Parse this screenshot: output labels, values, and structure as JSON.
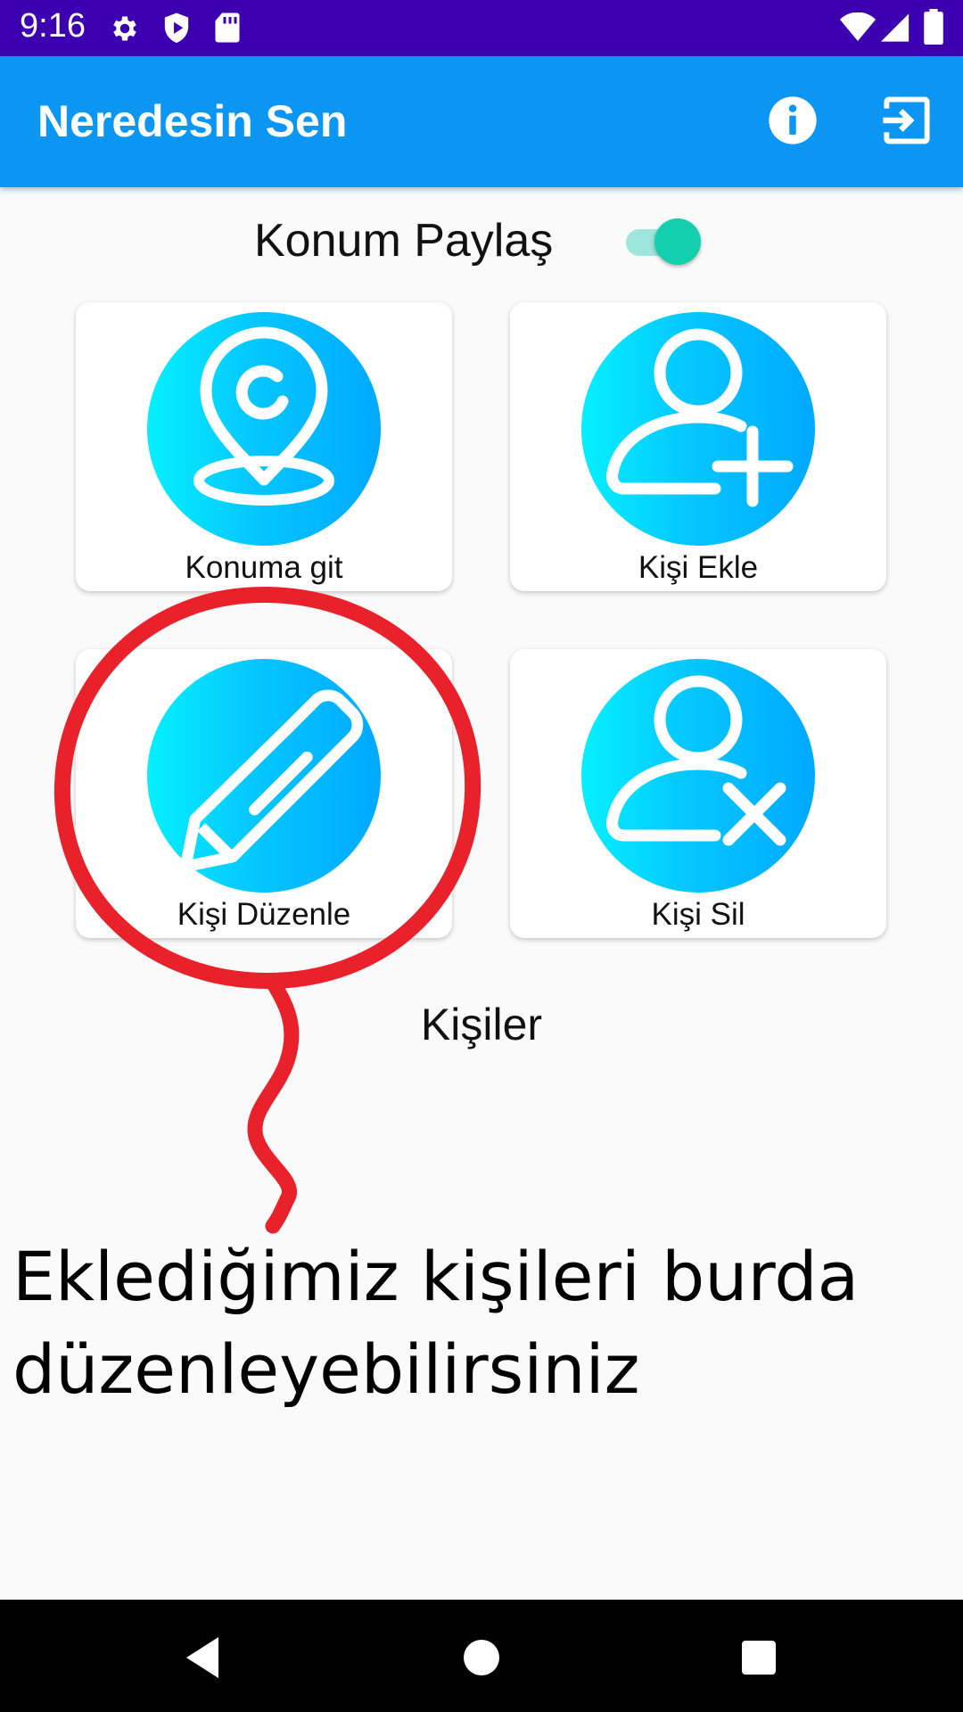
{
  "status_bar": {
    "time": "9:16",
    "left_icons": [
      "gear-icon",
      "shield-play-icon",
      "sd-card-icon"
    ],
    "right_icons": [
      "wifi-icon",
      "signal-icon",
      "battery-icon"
    ],
    "background": "#3c00b0"
  },
  "app_bar": {
    "title": "Neredesin Sen",
    "actions": [
      "info-icon",
      "logout-icon"
    ],
    "background": "#0b96f3"
  },
  "location_share": {
    "label": "Konum Paylaş",
    "enabled": true,
    "accent": "#13cfae"
  },
  "cards": [
    {
      "label": "Konuma git",
      "icon": "location-pin-icon"
    },
    {
      "label": "Kişi Ekle",
      "icon": "add-user-icon"
    },
    {
      "label": "Kişi Düzenle",
      "icon": "pencil-icon"
    },
    {
      "label": "Kişi Sil",
      "icon": "remove-user-icon"
    }
  ],
  "section_label": "Kişiler",
  "annotation": {
    "text": "Eklediğimiz kişileri burda düzenleyebilirsiniz",
    "color": "#e8212b"
  },
  "nav_bar": {
    "buttons": [
      "back-icon",
      "home-icon",
      "recents-icon"
    ]
  }
}
